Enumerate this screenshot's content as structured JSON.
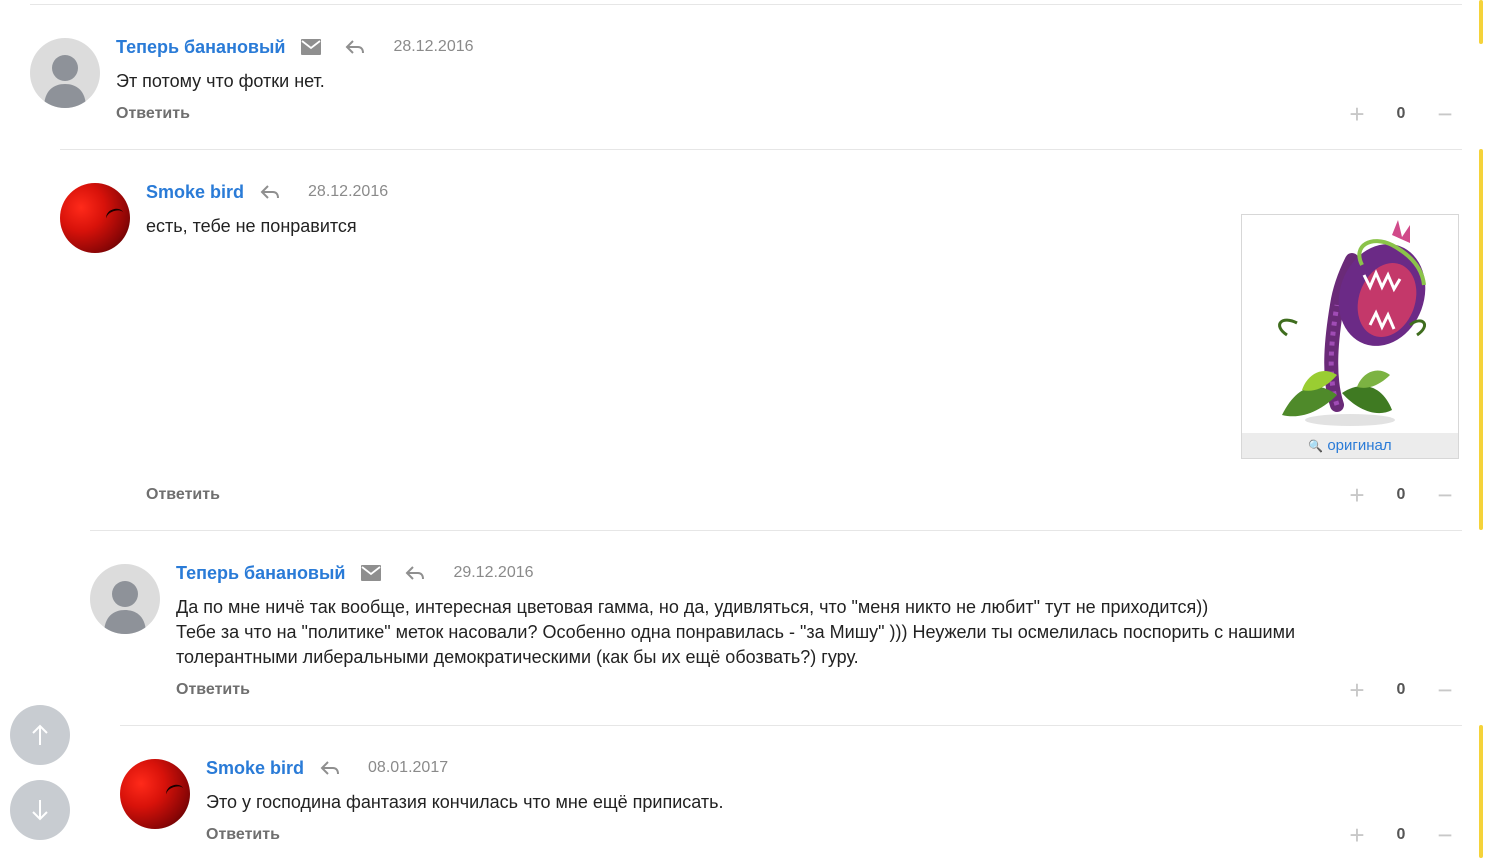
{
  "comments": [
    {
      "author": "Теперь банановый",
      "date": "28.12.2016",
      "text_lines": [
        "Эт потому что фотки нет."
      ],
      "reply_label": "Ответить",
      "votes": "0",
      "has_mail": true
    },
    {
      "author": "Smoke bird",
      "date": "28.12.2016",
      "text_lines": [
        "есть, тебе не понравится"
      ],
      "reply_label": "Ответить",
      "votes": "0",
      "has_mail": false,
      "attachment": {
        "link_label": "оригинал"
      }
    },
    {
      "author": "Теперь банановый",
      "date": "29.12.2016",
      "text_lines": [
        "Да по мне ничё так вообще, интересная цветовая гамма, но да, удивляться, что \"меня никто не любит\" тут не приходится))",
        "Тебе за что на \"политике\" меток насовали? Особенно одна понравилась - \"за Мишу\" ))) Неужели ты осмелилась поспорить с нашими",
        "толерантными либеральными демократическими (как бы их ещё обозвать?) гуру."
      ],
      "reply_label": "Ответить",
      "votes": "0",
      "has_mail": true
    },
    {
      "author": "Smoke bird",
      "date": "08.01.2017",
      "text_lines": [
        "Это у господина фантазия кончилась что мне ещё приписать."
      ],
      "reply_label": "Ответить",
      "votes": "0",
      "has_mail": false
    }
  ],
  "icons": {
    "mail": "envelope-icon",
    "reply": "reply-arrow-icon",
    "scroll_up": "arrow-up-icon",
    "scroll_down": "arrow-down-icon"
  },
  "colors": {
    "author": "#2a7bd7",
    "accent": "#f5d33a",
    "scroll_button": "#c8ccd1"
  }
}
